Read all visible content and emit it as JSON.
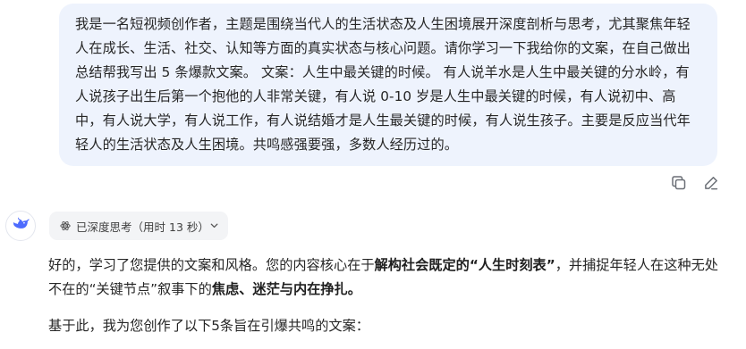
{
  "user_message": {
    "text": "我是一名短视频创作者，主题是围绕当代人的生活状态及人生困境展开深度剖析与思考，尤其聚焦年轻人在成长、生活、社交、认知等方面的真实状态与核心问题。请你学习一下我给你的文案，在自己做出总结帮我写出 5 条爆款文案。 文案：人生中最关键的时候。 有人说羊水是人生中最关键的分水岭，有人说孩子出生后第一个抱他的人非常关键，有人说 0-10 岁是人生中最关键的时候，有人说初中、高中，有人说大学，有人说工作，有人说结婚才是人生最关键的时候，有人说生孩子。主要是反应当代年轻人的生活状态及人生困境。共鸣感强要强，多数人经历过的。"
  },
  "message_actions": {
    "copy_icon": "copy-icon",
    "edit_icon": "edit-icon"
  },
  "assistant": {
    "avatar_icon": "whale-logo",
    "thinking": {
      "label": "已深度思考（用时 13 秒）",
      "icon": "atom-icon",
      "toggle_icon": "chevron-down-icon"
    },
    "response": {
      "p1_a": "好的，学习了您提供的文案和风格。您的内容核心在于",
      "p1_b": "解构社会既定的“人生时刻表”",
      "p1_c": "，并捕捉年轻人在这种无处不在的“关键节点”叙事下的",
      "p1_d": "焦虑、迷茫与内在挣扎。",
      "p2": "基于此，我为您创作了以下5条旨在引爆共鸣的文案："
    }
  },
  "colors": {
    "bubble_bg": "#eef3fd",
    "brand_blue": "#4d6bfe",
    "text": "#262626",
    "pill_bg": "#f3f4f6"
  }
}
